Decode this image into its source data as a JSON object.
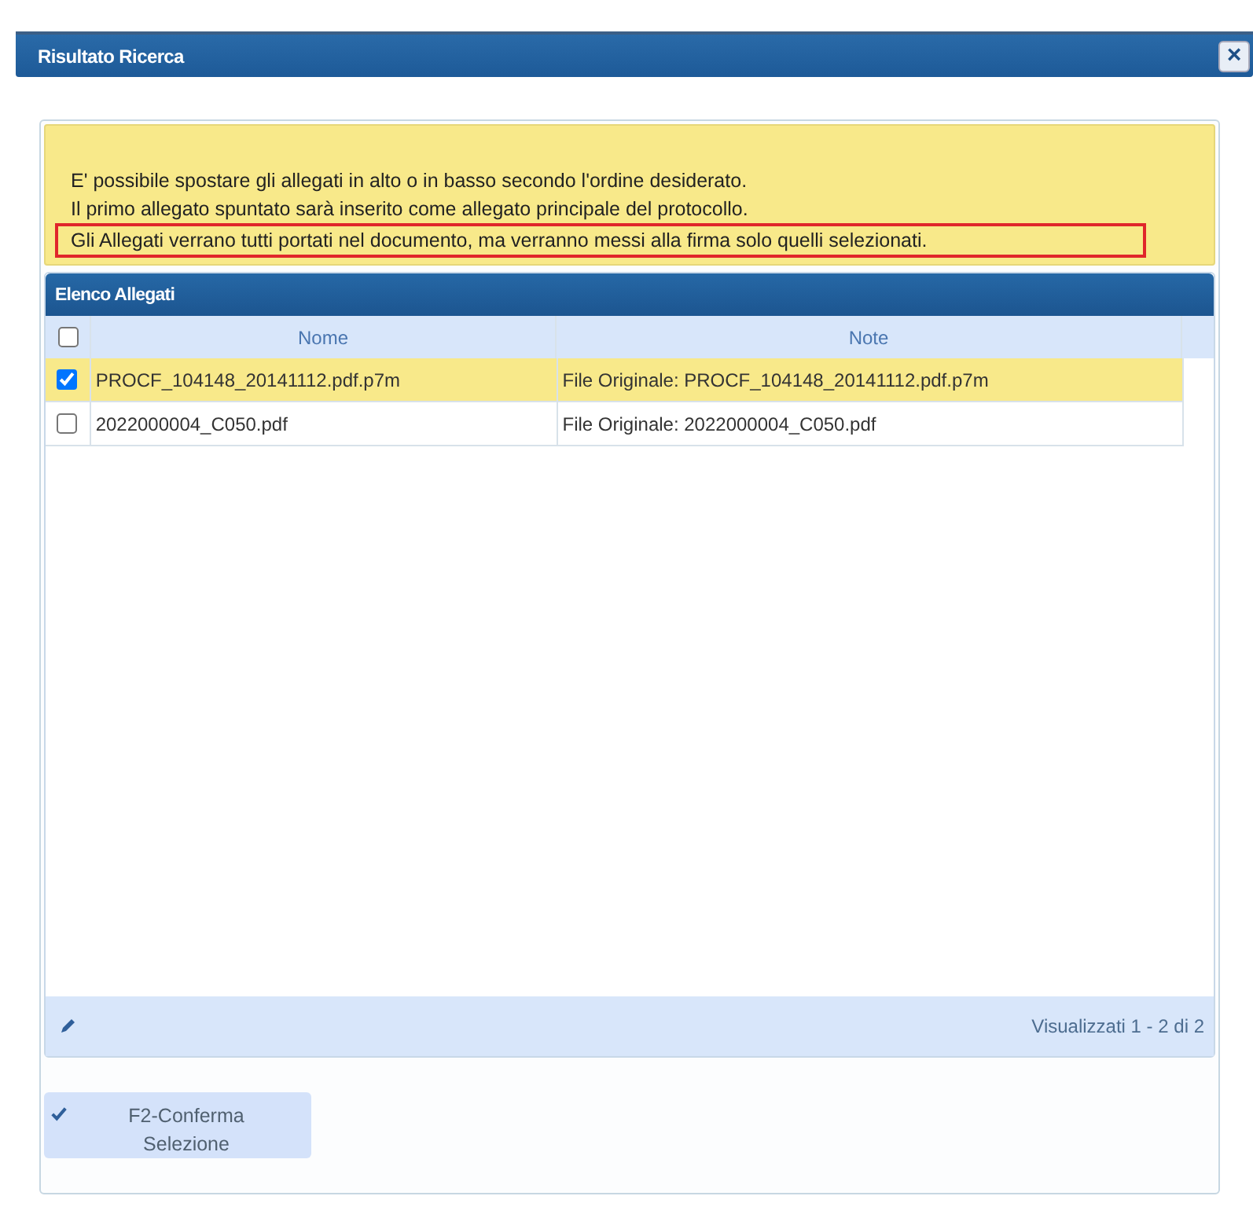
{
  "window": {
    "title": "Risultato Ricerca",
    "close": "×"
  },
  "notice": {
    "lines": [
      {
        "text": "E' possibile spostare gli allegati in alto o in basso secondo l'ordine desiderato.",
        "highlighted": false
      },
      {
        "text": "Il primo allegato spuntato sarà inserito come allegato principale del protocollo.",
        "highlighted": false
      },
      {
        "text": "Gli Allegati verrano tutti portati nel documento, ma verranno messi alla firma solo quelli selezionati.",
        "highlighted": true
      }
    ]
  },
  "grid": {
    "title": "Elenco Allegati",
    "select_all": {
      "checked": false
    },
    "columns": [
      "Nome",
      "Note"
    ],
    "rows": [
      {
        "nome": "PROCF_104148_20141112.pdf.p7m",
        "note": "File Originale: PROCF_104148_20141112.pdf.p7m",
        "checked": true,
        "selected": true
      },
      {
        "nome": "2022000004_C050.pdf",
        "note": "File Originale: 2022000004_C050.pdf",
        "checked": false,
        "selected": false
      }
    ],
    "footer": "Visualizzati 1 - 2 di 2"
  },
  "button": {
    "label": "F2-Conferma Selezione"
  }
}
